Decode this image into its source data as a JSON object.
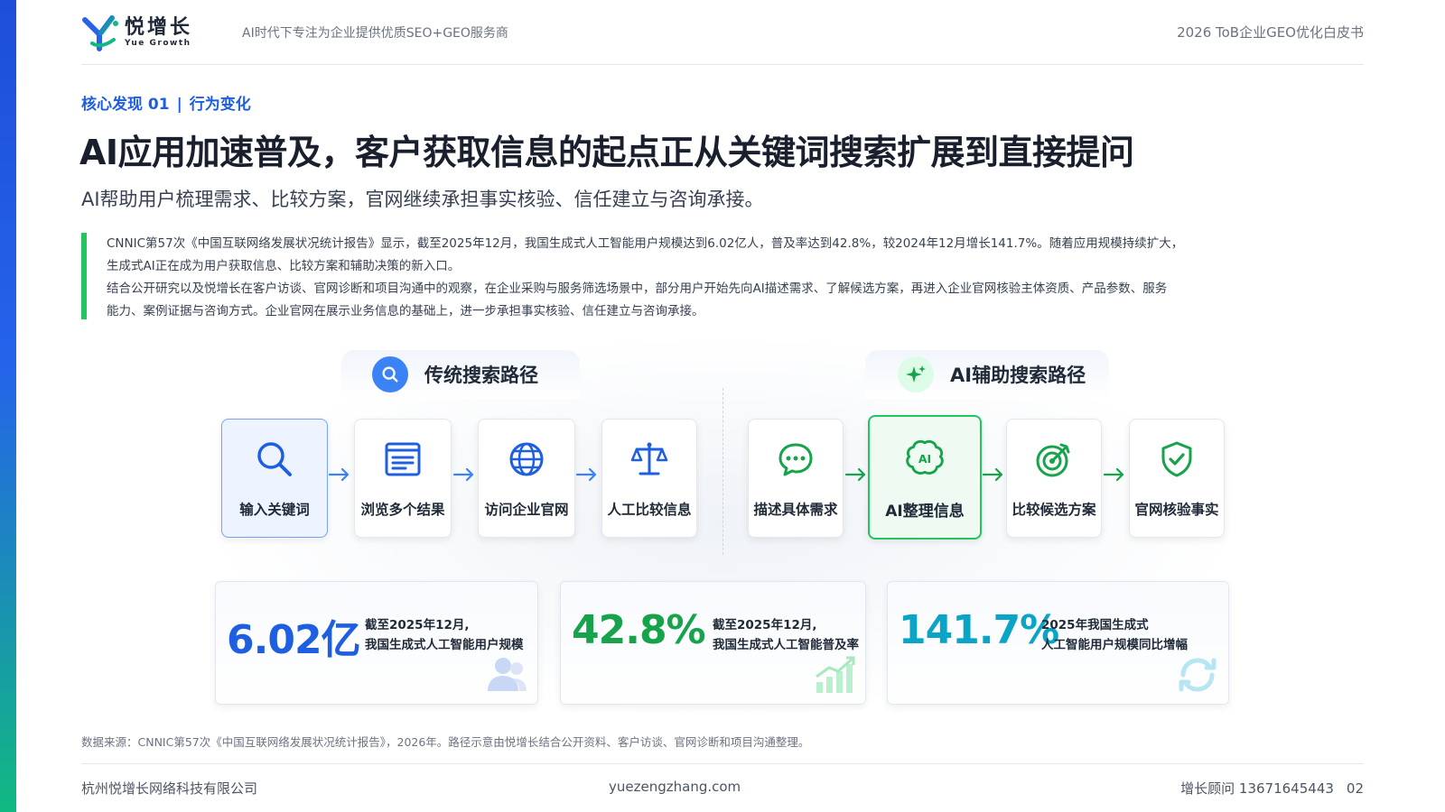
{
  "header": {
    "logo_cn": "悦增长",
    "logo_en": "Yue Growth",
    "tagline": "AI时代下专注为企业提供优质SEO+GEO服务商",
    "whitepaper": "2026 ToB企业GEO优化白皮书"
  },
  "kicker": {
    "finding": "核心发现 01",
    "separator": "|",
    "topic": "行为变化"
  },
  "title": "AI应用加速普及，客户获取信息的起点正从关键词搜索扩展到直接提问",
  "subtitle": "AI帮助用户梳理需求、比较方案，官网继续承担事实核验、信任建立与咨询承接。",
  "quote": {
    "line1": "CNNIC第57次《中国互联网络发展状况统计报告》显示，截至2025年12月，我国生成式人工智能用户规模达到6.02亿人，普及率达到42.8%，较2024年12月增长141.7%。随着应用规模持续扩大，",
    "line2": "生成式AI正在成为用户获取信息、比较方案和辅助决策的新入口。",
    "line3": "结合公开研究以及悦增长在客户访谈、官网诊断和项目沟通中的观察，在企业采购与服务筛选场景中，部分用户开始先向AI描述需求、了解候选方案，再进入企业官网核验主体资质、产品参数、服务",
    "line4": "能力、案例证据与咨询方式。企业官网在展示业务信息的基础上，进一步承担事实核验、信任建立与咨询承接。"
  },
  "traditional": {
    "title": "传统搜索路径",
    "steps": [
      "输入关键词",
      "浏览多个结果",
      "访问企业官网",
      "人工比较信息"
    ]
  },
  "ai": {
    "title": "AI辅助搜索路径",
    "steps": [
      "描述具体需求",
      "AI整理信息",
      "比较候选方案",
      "官网核验事实"
    ]
  },
  "stats": [
    {
      "value": "6.02亿",
      "desc1": "截至2025年12月,",
      "desc2": "我国生成式人工智能用户规模"
    },
    {
      "value": "42.8%",
      "desc1": "截至2025年12月,",
      "desc2": "我国生成式人工智能普及率"
    },
    {
      "value": "141.7%",
      "desc1": "2025年我国生成式",
      "desc2": "人工智能用户规模同比增幅"
    }
  ],
  "source": "数据来源：CNNIC第57次《中国互联网络发展状况统计报告》，2026年。路径示意由悦增长结合公开资料、客户访谈、官网诊断和项目沟通整理。",
  "footer": {
    "company": "杭州悦增长网络科技有限公司",
    "website": "yuezengzhang.com",
    "contact": "增长顾问 13671645443",
    "page": "02"
  },
  "colors": {
    "blue": "#1d5fe0",
    "green": "#16a34a",
    "cyan": "#0aa5c6",
    "stripe_top": "#1d4ed8",
    "stripe_bottom": "#10b981"
  }
}
